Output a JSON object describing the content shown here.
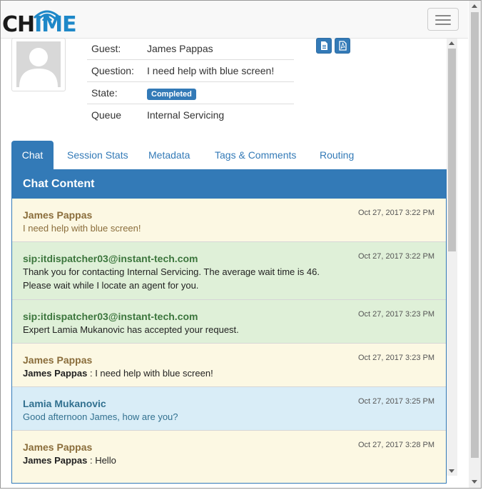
{
  "logo": {
    "text_a": "CH",
    "text_b": "I",
    "text_c": "ME"
  },
  "header": {
    "menu_icon": "hamburger-menu-icon"
  },
  "profile": {
    "rows": [
      {
        "label": "Guest:",
        "value": "James Pappas"
      },
      {
        "label": "Question:",
        "value": "I need help with blue screen!"
      },
      {
        "label": "State:",
        "value": "Completed"
      },
      {
        "label": "Queue",
        "value": "Internal Servicing"
      }
    ],
    "icons": [
      "document-icon",
      "pdf-icon"
    ]
  },
  "tabs": [
    "Chat",
    "Session Stats",
    "Metadata",
    "Tags & Comments",
    "Routing"
  ],
  "panel": {
    "title": "Chat Content"
  },
  "messages": [
    {
      "sender": "James Pappas",
      "time": "Oct 27, 2017 3:22 PM",
      "lines": [
        "I need help with blue screen!"
      ]
    },
    {
      "sender": "sip:itdispatcher03@instant-tech.com",
      "time": "Oct 27, 2017 3:22 PM",
      "lines": [
        "Thank you for contacting Internal Servicing. The average wait time is 46.",
        "Please wait while I locate an agent for you."
      ]
    },
    {
      "sender": "sip:itdispatcher03@instant-tech.com",
      "time": "Oct 27, 2017 3:23 PM",
      "lines": [
        "Expert Lamia Mukanovic has accepted your request."
      ]
    },
    {
      "sender": "James Pappas",
      "time": "Oct 27, 2017 3:23 PM",
      "prefix": "James Pappas",
      "sep": " : ",
      "lines": [
        "I need help with blue screen!"
      ]
    },
    {
      "sender": "Lamia Mukanovic",
      "time": "Oct 27, 2017 3:25 PM",
      "lines": [
        "Good afternoon James, how are you?"
      ]
    },
    {
      "sender": "James Pappas",
      "time": "Oct 27, 2017 3:28 PM",
      "prefix": "James Pappas",
      "sep": " : ",
      "lines": [
        "Hello"
      ]
    }
  ],
  "colors": {
    "primary": "#337ab7",
    "guest_bg": "#fcf8e3",
    "bot_bg": "#dff0d8",
    "agent_bg": "#d9edf7"
  }
}
